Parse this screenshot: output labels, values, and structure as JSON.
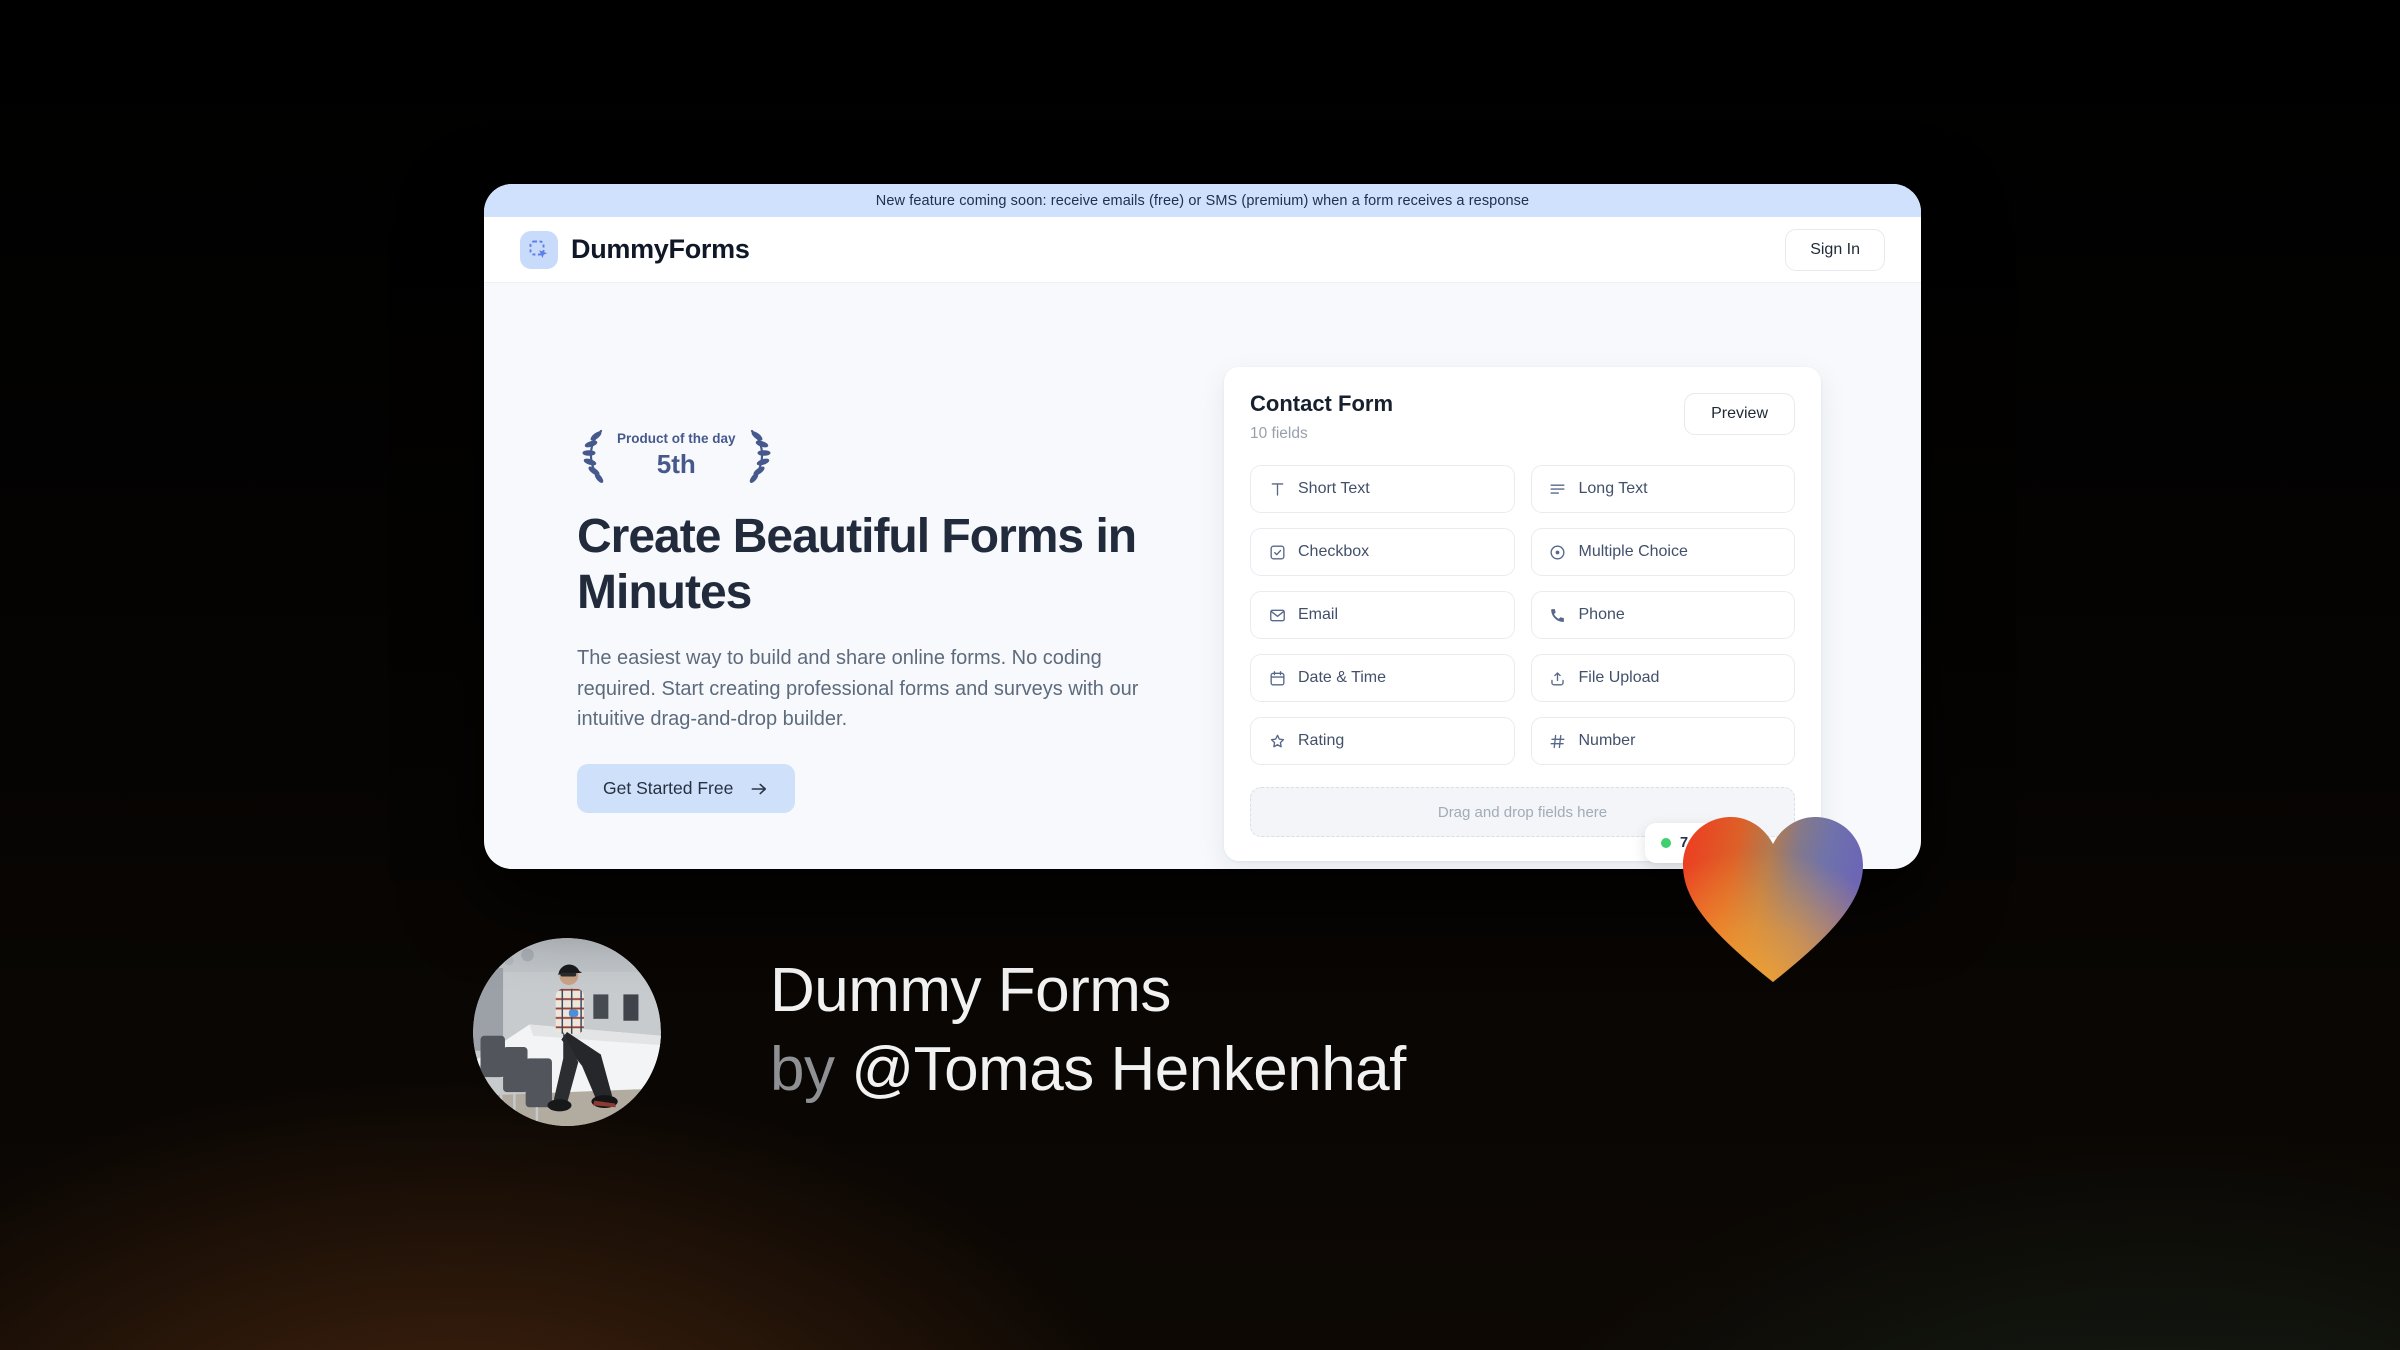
{
  "announcement": {
    "text": "New feature coming soon: receive emails (free) or SMS (premium) when a form receives a response"
  },
  "header": {
    "brand": "DummyForms",
    "sign_in_label": "Sign In"
  },
  "hero": {
    "award": {
      "line1": "Product of the day",
      "rank": "5th"
    },
    "title": "Create Beautiful Forms in Minutes",
    "description": "The easiest way to build and share online forms. No coding required. Start creating professional forms and surveys with our intuitive drag-and-drop builder.",
    "cta_label": "Get Started Free"
  },
  "form_builder": {
    "title": "Contact Form",
    "field_count": "10 fields",
    "preview_label": "Preview",
    "fields": [
      {
        "icon": "short-text",
        "label": "Short Text"
      },
      {
        "icon": "long-text",
        "label": "Long Text"
      },
      {
        "icon": "checkbox",
        "label": "Checkbox"
      },
      {
        "icon": "multiple-choice",
        "label": "Multiple Choice"
      },
      {
        "icon": "email",
        "label": "Email"
      },
      {
        "icon": "phone",
        "label": "Phone"
      },
      {
        "icon": "date-time",
        "label": "Date & Time"
      },
      {
        "icon": "file-upload",
        "label": "File Upload"
      },
      {
        "icon": "rating",
        "label": "Rating"
      },
      {
        "icon": "number",
        "label": "Number"
      }
    ],
    "dropzone_text": "Drag and drop fields here",
    "status_badge": {
      "visible_text": "7"
    }
  },
  "caption": {
    "product_name": "Dummy Forms",
    "by_label": "by",
    "author": "@Tomas Henkenhaf"
  },
  "colors": {
    "accent_blue": "#cfe0fb",
    "banner_blue": "#cfe1fc",
    "award_navy": "#46598c",
    "status_green": "#3ecf6f",
    "heart_red": "#ee3a21",
    "heart_orange": "#f5a02d",
    "heart_purple": "#6c66b5"
  }
}
